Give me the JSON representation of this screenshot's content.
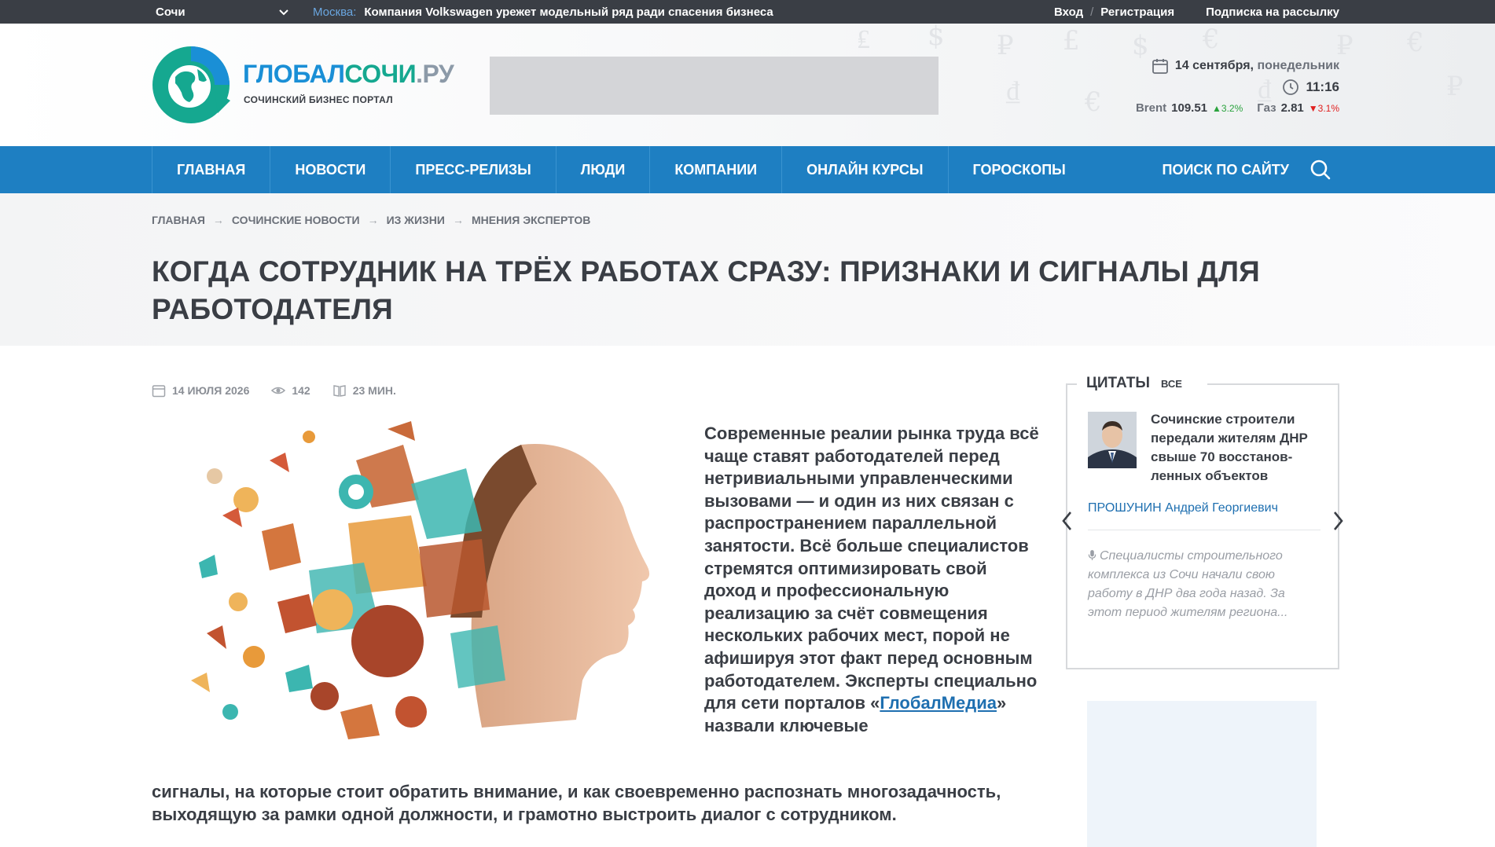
{
  "topbar": {
    "city": "Сочи",
    "ticker_label": "Москва:",
    "ticker_text": "Компания Volkswagen урежет модельный ряд ради спасения бизнеса",
    "login": "Вход",
    "separator": "/",
    "register": "Регистрация",
    "subscribe": "Подписка на рассылку"
  },
  "logo": {
    "name_part1": "ГЛОБАЛ",
    "name_part2": "СОЧИ",
    "name_part3": ".РУ",
    "tagline": "СОЧИНСКИЙ БИЗНЕС ПОРТАЛ"
  },
  "header_info": {
    "date": "14 сентября,",
    "weekday": "понедельник",
    "time": "11:16",
    "brent_label": "Brent",
    "brent_value": "109.51",
    "brent_change": "▲3.2%",
    "gas_label": "Газ",
    "gas_value": "2.81",
    "gas_change": "▼3.1%"
  },
  "nav": {
    "items": [
      "ГЛАВНАЯ",
      "НОВОСТИ",
      "ПРЕСС-РЕЛИЗЫ",
      "ЛЮДИ",
      "КОМПАНИИ",
      "ОНЛАЙН КУРСЫ",
      "ГОРОСКОПЫ"
    ],
    "search_label": "ПОИСК ПО САЙТУ"
  },
  "breadcrumbs": {
    "items": [
      "ГЛАВНАЯ",
      "СОЧИНСКИЕ НОВОСТИ",
      "ИЗ ЖИЗНИ",
      "МНЕНИЯ ЭКСПЕРТОВ"
    ],
    "arrow": "→"
  },
  "article": {
    "title": "КОГДА СОТРУДНИК НА ТРЁХ РАБОТАХ СРАЗУ: ПРИЗНАКИ И СИГНАЛЫ ДЛЯ РАБОТОДАТЕЛЯ",
    "date": "14 ИЮЛЯ 2026",
    "views": "142",
    "read_time": "23 МИН.",
    "lead_part1": "Современные реалии рынка труда всё чаще ставят работодателей перед нетривиальными управленческими вызовами — и один из них связан с распространением параллельной занятости. Всё больше специалистов стремятся оптимизировать свой доход и профессиональную реализацию за счёт совмещения нескольких рабочих мест, порой не афишируя этот факт перед основным работодателем. Эксперты специально для сети порталов «",
    "lead_link": "ГлобалМедиа",
    "lead_part2": "» назвали ключевые",
    "lead_cont": "сигналы, на которые стоит обратить внимание, и как своевременно распознать многозадачность, выходящую за рамки одной должности, и грамотно выстроить диалог с сотрудником."
  },
  "quotes": {
    "heading": "ЦИТАТЫ",
    "all_link": "ВСЕ",
    "quote_title": "Сочинские строители передали жителям ДНР свыше 70 восстанов-ленных объектов",
    "author": "ПРОШУНИН Андрей Георгиевич",
    "text": "Специалисты строительного комплекса из Сочи начали свою работу в ДНР два года назад. За этот период жителям региона..."
  },
  "colors": {
    "topbar": "#3a3e45",
    "nav": "#1e7fc2",
    "brand_blue": "#1a8fd6",
    "brand_teal": "#15a890",
    "text": "#3a3e45",
    "link": "#1e6fb0",
    "up": "#2aa33d",
    "down": "#e02020"
  }
}
